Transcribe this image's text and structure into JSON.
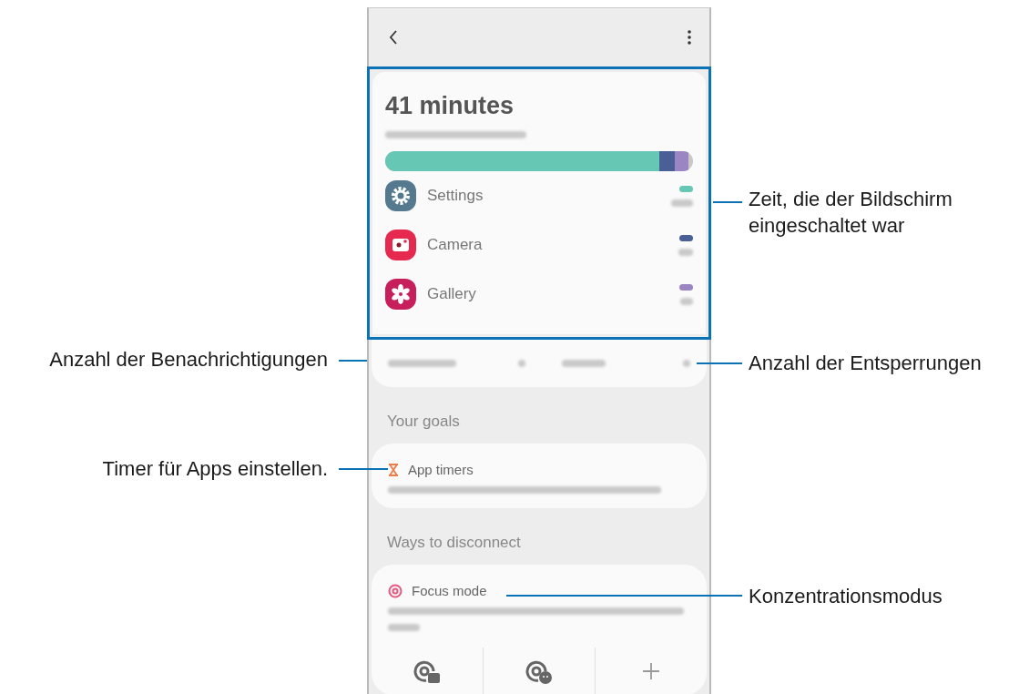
{
  "usage": {
    "total": "41 minutes",
    "apps": [
      {
        "kind": "settings",
        "name": "Settings",
        "color": "#66c7b4"
      },
      {
        "kind": "camera",
        "name": "Camera",
        "color": "#4a5f96"
      },
      {
        "kind": "gallery",
        "name": "Gallery",
        "color": "#9b86c3"
      }
    ]
  },
  "goals": {
    "heading": "Your goals",
    "app_timers": {
      "title": "App timers"
    }
  },
  "disconnect": {
    "heading": "Ways to disconnect",
    "focus_mode": {
      "title": "Focus mode"
    }
  },
  "callouts": [
    {
      "text": "Zeit, die der Bildschirm eingeschaltet war"
    },
    {
      "text": "Anzahl der Benachrichtigungen"
    },
    {
      "text": "Anzahl der Entsperrungen"
    },
    {
      "text": "Timer für Apps einstellen."
    },
    {
      "text": "Konzentrationsmodus"
    }
  ]
}
